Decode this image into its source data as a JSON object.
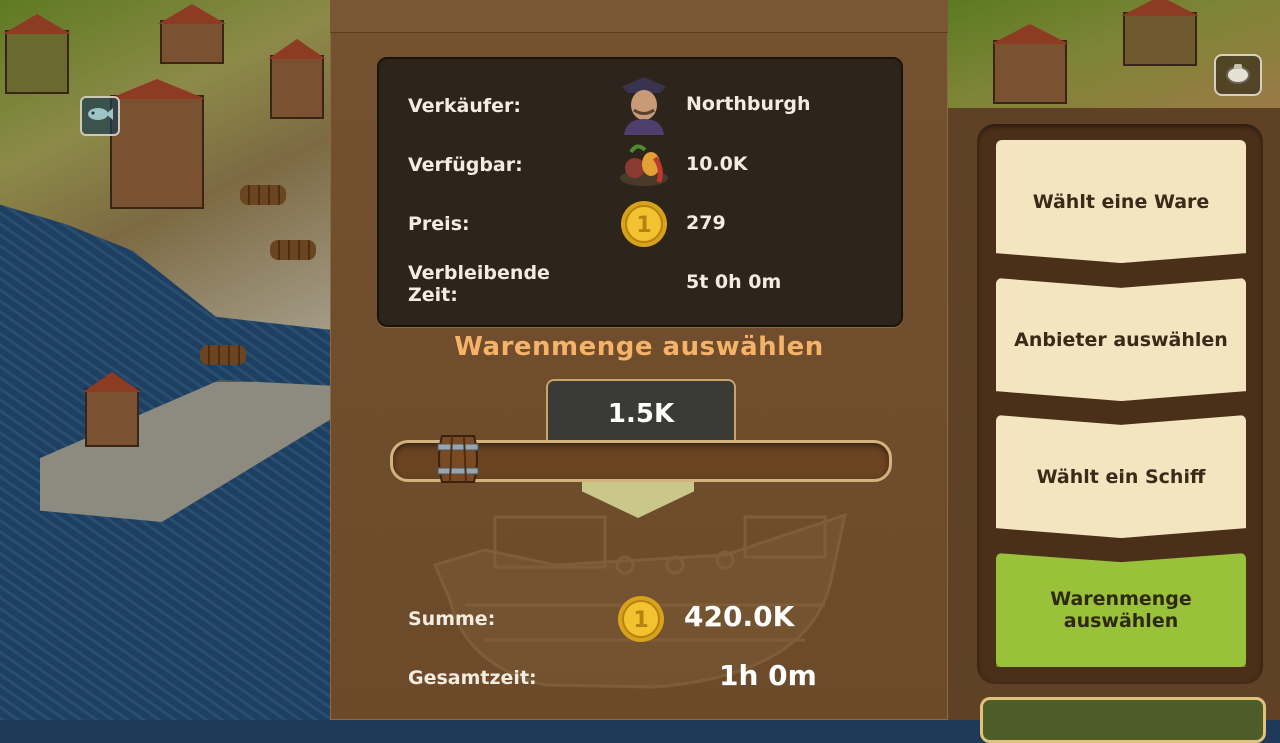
{
  "trade": {
    "seller_label": "Verkäufer:",
    "seller_value": "Northburgh",
    "available_label": "Verfügbar:",
    "available_value": "10.0K",
    "price_label": "Preis:",
    "price_value": "279",
    "remaining_label": "Verbleibende Zeit:",
    "remaining_value": "5t 0h 0m"
  },
  "quantity": {
    "title": "Warenmenge auswählen",
    "selected": "1.5K",
    "slider_fraction": 0.15
  },
  "totals": {
    "sum_label": "Summe:",
    "sum_value": "420.0K",
    "time_label": "Gesamtzeit:",
    "time_value": "1h 0m"
  },
  "steps": [
    {
      "label": "Wählt eine Ware"
    },
    {
      "label": "Anbieter auswählen"
    },
    {
      "label": "Wählt ein Schiff"
    },
    {
      "label": "Warenmenge auswählen"
    }
  ],
  "icons": {
    "seller": "merchant-portrait-icon",
    "available": "goods-produce-icon",
    "price": "coin-icon",
    "sum": "coin-icon",
    "slider": "barrel-icon",
    "map_marker": "fish-icon",
    "corner": "cargo-sack-icon"
  },
  "colors": {
    "panel_brown": "#6b4a2a",
    "title_orange": "#f6b269",
    "step_cream": "#f3e5c0",
    "step_active_green": "#9ac13a",
    "coin_gold": "#f2c230"
  }
}
